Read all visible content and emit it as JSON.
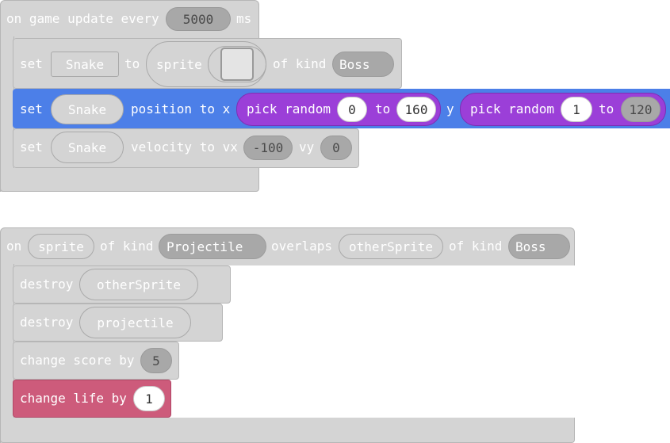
{
  "block1": {
    "event": {
      "label": "on game update every",
      "interval": "5000",
      "unit": "ms"
    },
    "set_sprite": {
      "set": "set",
      "var": "Snake",
      "to": "to",
      "sprite": "sprite",
      "of_kind": "of kind",
      "kind": "Boss"
    },
    "set_position": {
      "set": "set",
      "var": "Snake",
      "position_to_x": "position to x",
      "pick_random": "pick random",
      "x_min": "0",
      "to": "to",
      "x_max": "160",
      "y": "y",
      "y_min": "1",
      "y_max": "120"
    },
    "set_velocity": {
      "set": "set",
      "var": "Snake",
      "velocity_to_vx": "velocity to vx",
      "vx": "-100",
      "vy_label": "vy",
      "vy": "0"
    }
  },
  "block2": {
    "event": {
      "on": "on",
      "sprite": "sprite",
      "of_kind": "of kind",
      "kind1": "Projectile",
      "overlaps": "overlaps",
      "other": "otherSprite",
      "kind2": "Boss"
    },
    "destroy1": {
      "label": "destroy",
      "target": "otherSprite"
    },
    "destroy2": {
      "label": "destroy",
      "target": "projectile"
    },
    "change_score": {
      "label": "change score by",
      "value": "5"
    },
    "change_life": {
      "label": "change life by",
      "value": "1"
    }
  },
  "colors": {
    "gray": "#d4d4d4",
    "blue": "#4c7fe8",
    "purple": "#9b3fd8",
    "red": "#cd5b7b"
  }
}
